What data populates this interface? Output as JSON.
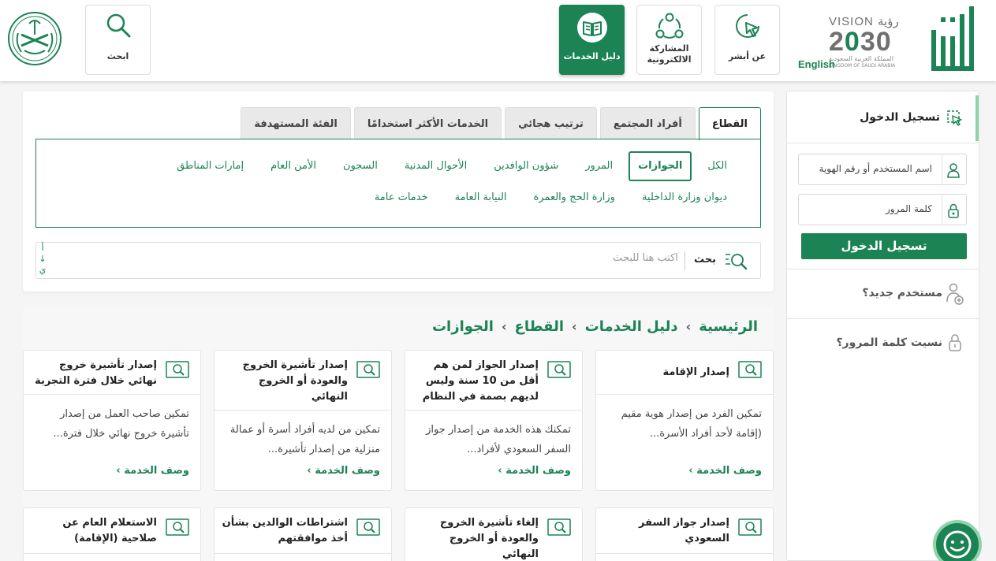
{
  "header": {
    "vision": {
      "top": "VISION رؤية",
      "num_left": "2",
      "num_mid": "0",
      "num_right": "30",
      "ar": "المملكة العربية السعودية",
      "en": "KINGDOM OF SAUDI ARABIA"
    },
    "nav": [
      {
        "label": "عن أبشر",
        "icon": "cursor-icon"
      },
      {
        "label": "المشاركة الالكترونية",
        "icon": "share-network-icon"
      },
      {
        "label": "دليل الخدمات",
        "icon": "book-icon"
      }
    ],
    "search_tile": {
      "label": "ابحث",
      "icon": "search-icon"
    },
    "lang": "English"
  },
  "sidebar": {
    "login_title": "تسجيل الدخول",
    "username_placeholder": "اسم المستخدم أو رقم الهوية",
    "password_placeholder": "كلمة المرور",
    "login_button": "تسجيل الدخول",
    "new_user": "مستخدم جديد؟",
    "forgot_password": "نسيت كلمة المرور؟"
  },
  "filter": {
    "tabs": [
      "القطاع",
      "أفراد المجتمع",
      "ترتيب هجائي",
      "الخدمات الأكثر استخدامًا",
      "الفئة المستهدفة"
    ],
    "sectors_row1": [
      "الكل",
      "الجوازات",
      "المرور",
      "شؤون الوافدين",
      "الأحوال المدنية",
      "السجون",
      "الأمن العام",
      "إمارات المناطق"
    ],
    "sectors_row2": [
      "ديوان وزارة الداخلية",
      "وزارة الحج والعمرة",
      "النيابة العامة",
      "خدمات عامة"
    ],
    "search_label": "بحث",
    "search_placeholder": "اكتب هنا للبحث",
    "sort_glyphs": [
      "أ",
      "↓",
      "ي"
    ]
  },
  "breadcrumb": [
    "الرئيسية",
    "دليل الخدمات",
    "القطاع",
    "الجوازات"
  ],
  "more_label": "وصف الخدمة",
  "cards_row1": [
    {
      "title": "إصدار الإقامة",
      "desc": "تمكين الفرد من إصدار هوية مقيم (إقامة لأحد أفراد الأسرة..."
    },
    {
      "title": "إصدار الجواز لمن هم أقل من 10 سنة وليس لديهم بصمة في النظام",
      "desc": "تمكنك هذه الخدمة من إصدار جواز السفر السعودي لأفراد..."
    },
    {
      "title": "إصدار تأشيرة الخروج والعودة أو الخروج النهائي",
      "desc": "تمكين من لديه أفراد أسرة أو عمالة منزلية من إصدار تأشيرة..."
    },
    {
      "title": "إصدار تأشيرة خروج نهائي خلال فترة التجربة",
      "desc": "تمكين صاحب العمل من إصدار تأشيرة خروج نهائي خلال فترة..."
    }
  ],
  "cards_row2": [
    {
      "title": "إصدار جواز السفر السعودي"
    },
    {
      "title": "إلغاء تأشيرة الخروج والعودة أو الخروج النهائي"
    },
    {
      "title": "اشتراطات الوالدين بشأن أخذ موافقتهم"
    },
    {
      "title": "الاستعلام العام عن صلاحية (الإقامة)"
    }
  ],
  "colors": {
    "brand": "#1b8354",
    "accent_light": "#8fd3aa"
  }
}
